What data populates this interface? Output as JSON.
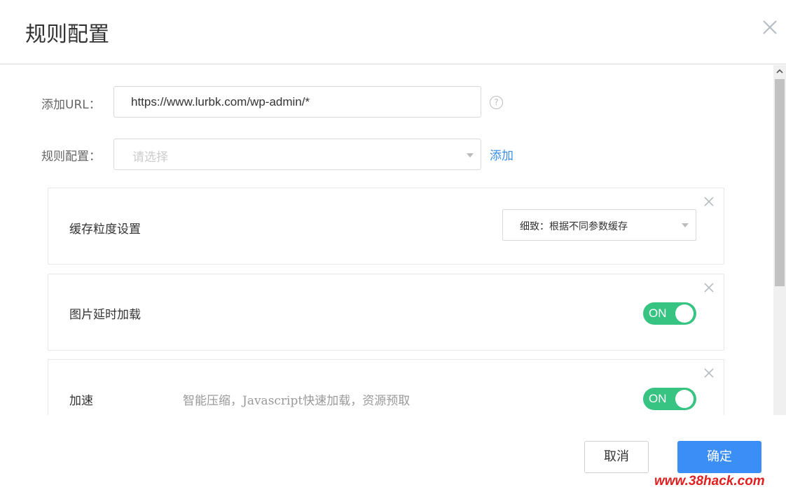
{
  "dialog": {
    "title": "规则配置"
  },
  "form": {
    "url_label": "添加URL：",
    "url_value": "https://www.lurbk.com/wp-admin/*",
    "help_icon": "question-circle-icon",
    "rule_label": "规则配置：",
    "rule_placeholder": "请选择",
    "add_link": "添加"
  },
  "cards": [
    {
      "title": "缓存粒度设置",
      "select_value": "细致：根据不同参数缓存"
    },
    {
      "title": "图片延时加载",
      "toggle": "ON"
    },
    {
      "title": "加速",
      "desc": "智能压缩，Javascript快速加载，资源预取",
      "toggle": "ON"
    }
  ],
  "footer": {
    "cancel": "取消",
    "confirm": "确定",
    "watermark": "www.38hack.com"
  },
  "colors": {
    "primary": "#3a8ef6",
    "toggle_on": "#37c381",
    "link": "#3a8ee6"
  }
}
